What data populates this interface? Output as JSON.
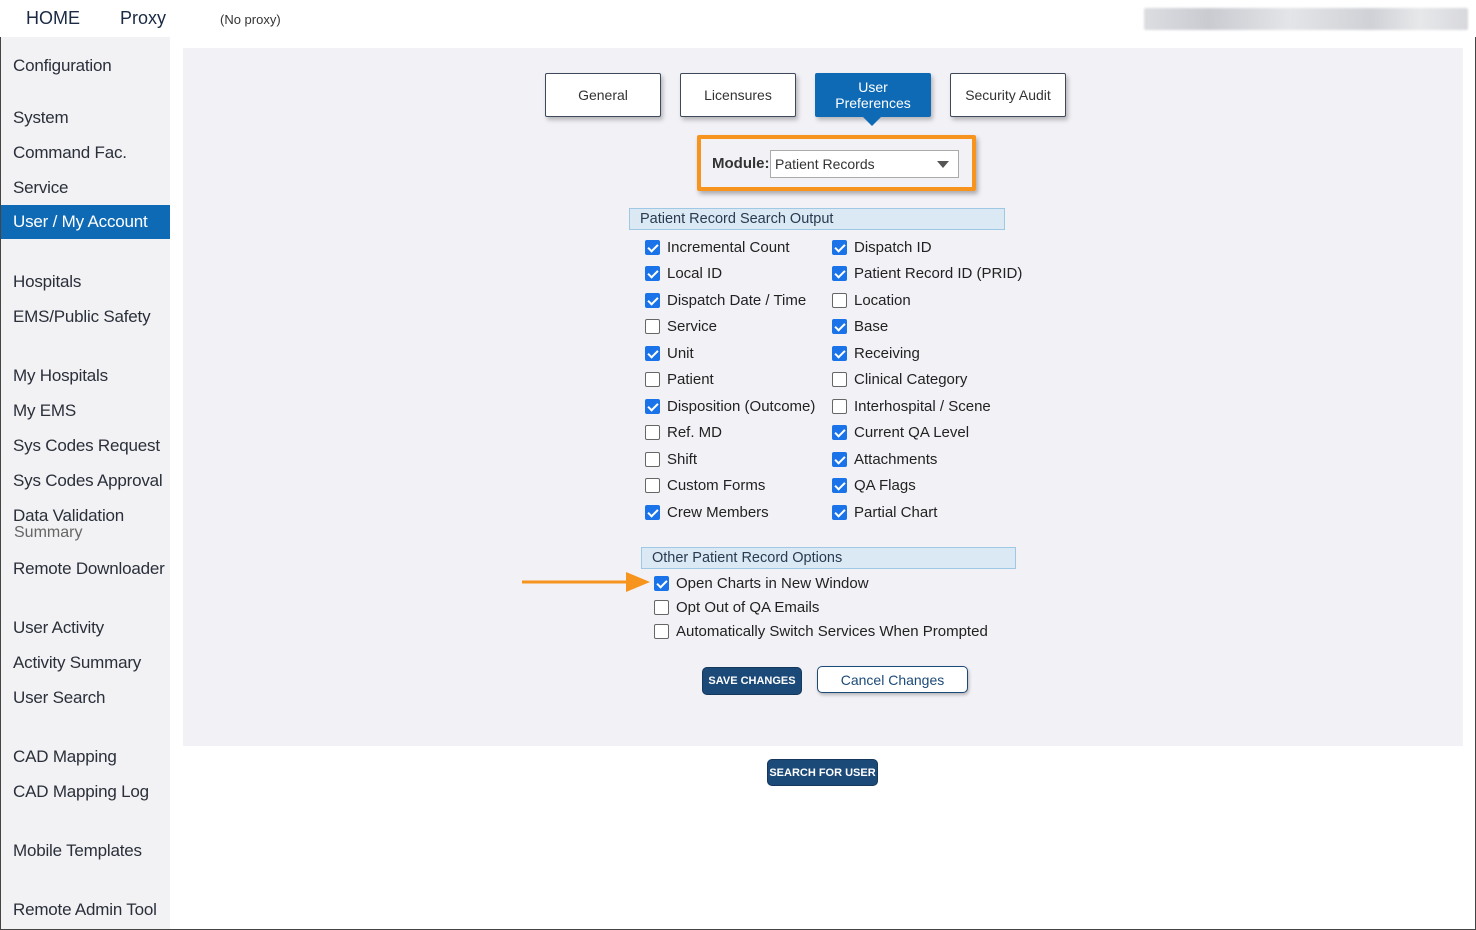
{
  "topbar": {
    "home_label": "HOME",
    "proxy_label": "Proxy",
    "proxy_status": "(No proxy)"
  },
  "sidebar": {
    "items": [
      {
        "label": "Configuration"
      },
      {
        "label": "System"
      },
      {
        "label": "Command Fac."
      },
      {
        "label": "Service"
      },
      {
        "label": "User / My Account",
        "active": true
      },
      {
        "label": "Hospitals"
      },
      {
        "label": "EMS/Public Safety"
      },
      {
        "label": "My Hospitals"
      },
      {
        "label": "My EMS"
      },
      {
        "label": "Sys Codes Request"
      },
      {
        "label": "Sys Codes Approval"
      },
      {
        "label": "Data Validation",
        "sublabel": "Summary"
      },
      {
        "label": "Remote Downloader"
      },
      {
        "label": "User Activity"
      },
      {
        "label": "Activity Summary"
      },
      {
        "label": "User Search"
      },
      {
        "label": "CAD Mapping"
      },
      {
        "label": "CAD Mapping Log"
      },
      {
        "label": "Mobile Templates"
      },
      {
        "label": "Remote Admin Tool"
      }
    ]
  },
  "tabs": [
    {
      "label": "General"
    },
    {
      "label": "Licensures"
    },
    {
      "label": "User Preferences",
      "active": true
    },
    {
      "label": "Security Audit"
    }
  ],
  "module": {
    "label": "Module:",
    "selected": "Patient Records"
  },
  "search_output": {
    "title": "Patient Record Search Output",
    "left": [
      {
        "label": "Incremental Count",
        "checked": true
      },
      {
        "label": "Local ID",
        "checked": true
      },
      {
        "label": "Dispatch Date / Time",
        "checked": true
      },
      {
        "label": "Service",
        "checked": false
      },
      {
        "label": "Unit",
        "checked": true
      },
      {
        "label": "Patient",
        "checked": false
      },
      {
        "label": "Disposition (Outcome)",
        "checked": true
      },
      {
        "label": "Ref. MD",
        "checked": false
      },
      {
        "label": "Shift",
        "checked": false
      },
      {
        "label": "Custom Forms",
        "checked": false
      },
      {
        "label": "Crew Members",
        "checked": true
      }
    ],
    "right": [
      {
        "label": "Dispatch ID",
        "checked": true
      },
      {
        "label": "Patient Record ID (PRID)",
        "checked": true
      },
      {
        "label": "Location",
        "checked": false
      },
      {
        "label": "Base",
        "checked": true
      },
      {
        "label": "Receiving",
        "checked": true
      },
      {
        "label": "Clinical Category",
        "checked": false
      },
      {
        "label": "Interhospital / Scene",
        "checked": false
      },
      {
        "label": "Current QA Level",
        "checked": true
      },
      {
        "label": "Attachments",
        "checked": true
      },
      {
        "label": "QA Flags",
        "checked": true
      },
      {
        "label": "Partial Chart",
        "checked": true
      }
    ]
  },
  "other_options": {
    "title": "Other Patient Record Options",
    "items": [
      {
        "label": "Open Charts in New Window",
        "checked": true
      },
      {
        "label": "Opt Out of QA Emails",
        "checked": false
      },
      {
        "label": "Automatically Switch Services When Prompted",
        "checked": false
      }
    ]
  },
  "actions": {
    "save_label": "SAVE CHANGES",
    "cancel_label": "Cancel Changes",
    "search_user_label": "SEARCH FOR USER"
  },
  "colors": {
    "accent": "#0e6ab5",
    "highlight": "#f7941d",
    "button_dark": "#1c4a78"
  }
}
